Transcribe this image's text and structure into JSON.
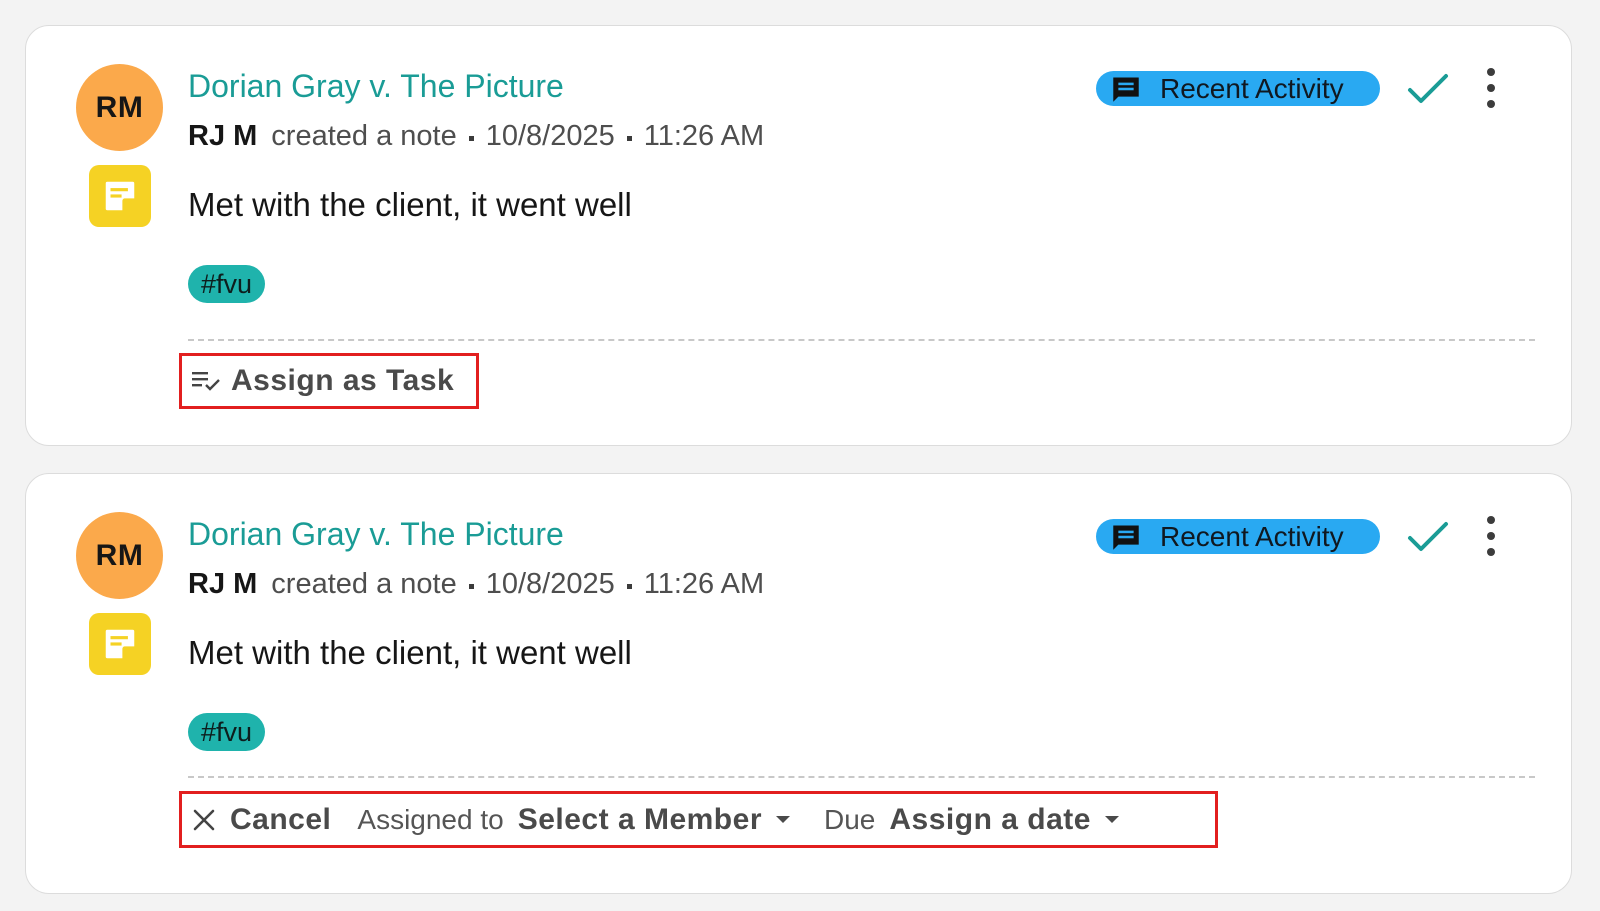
{
  "cards": [
    {
      "avatar_initials": "RM",
      "title": "Dorian Gray v. The Picture",
      "author": "RJ M",
      "action": "created a note",
      "date": "10/8/2025",
      "time": "11:26 AM",
      "body": "Met with the client, it went well",
      "tag": "#fvu",
      "badge_label": "Recent Activity",
      "assign_task_label": "Assign as Task"
    },
    {
      "avatar_initials": "RM",
      "title": "Dorian Gray v. The Picture",
      "author": "RJ M",
      "action": "created a note",
      "date": "10/8/2025",
      "time": "11:26 AM",
      "body": "Met with the client, it went well",
      "tag": "#fvu",
      "badge_label": "Recent Activity",
      "task_form": {
        "cancel_label": "Cancel",
        "assigned_to_label": "Assigned to",
        "member_select": "Select a Member",
        "due_label": "Due",
        "date_select": "Assign a date"
      }
    }
  ],
  "colors": {
    "avatar_bg": "#fba94b",
    "note_icon_bg": "#f5d224",
    "title": "#1a9c96",
    "tag_bg": "#1fb3ac",
    "badge_bg": "#29a9f2",
    "check": "#1a9c96",
    "highlight_border": "#e21f1f"
  },
  "icons": {
    "note": "sticky-note-icon",
    "badge": "chat-bubble-icon",
    "resolve": "checkmark-icon",
    "menu": "more-vert-icon",
    "assign": "playlist-check-icon",
    "cancel": "close-icon",
    "dropdown": "caret-down-icon"
  }
}
